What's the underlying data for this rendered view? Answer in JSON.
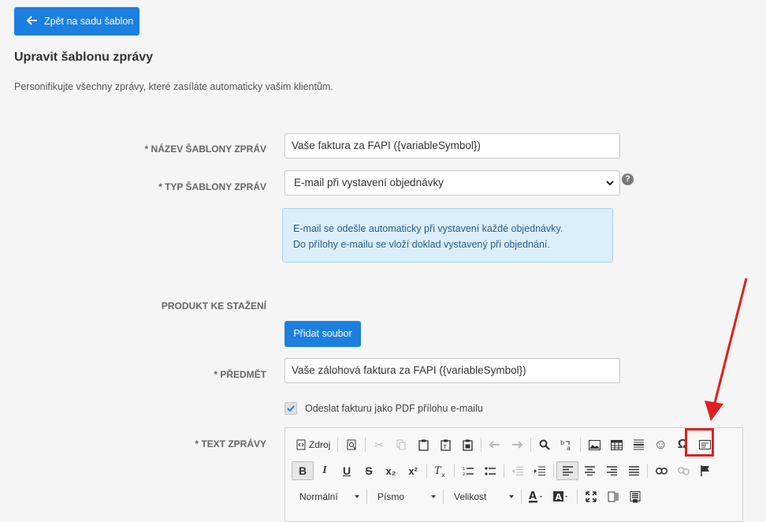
{
  "back_button": {
    "label": "Zpět na sadu šablon",
    "icon": "arrow-left-icon"
  },
  "page": {
    "title": "Upravit šablonu zprávy",
    "subtitle": "Personifikujte všechny zprávy, které zasíláte automaticky vašim klientům."
  },
  "form": {
    "name": {
      "label": "* NÁZEV ŠABLONY ZPRÁV",
      "value": "Vaše faktura za FAPI ({variableSymbol})"
    },
    "type": {
      "label": "* TYP ŠABLONY ZPRÁV",
      "value": "E-mail při vystavení objednávky",
      "help": "?"
    },
    "info": {
      "line1": "E-mail se odešle automaticky při vystavení každé objednávky.",
      "line2": "Do přílohy e-mailu se vloží doklad vystavený při objednání."
    },
    "download": {
      "label": "PRODUKT KE STAŽENÍ",
      "button": "Přidat soubor"
    },
    "subject": {
      "label": "* PŘEDMĚT",
      "value": "Vaše zálohová faktura za FAPI ({variableSymbol})"
    },
    "attach_pdf": {
      "label": "Odeslat fakturu jako PDF přílohu e-mailu",
      "checked": true
    },
    "body": {
      "label": "* TEXT ZPRÁVY"
    }
  },
  "editor": {
    "source_label": "Zdroj",
    "format_combo": "Normální",
    "font_combo": "Písmo",
    "size_combo": "Velikost",
    "superscript_glyph": "x²",
    "subscript_glyph": "x₂",
    "bold_glyph": "B",
    "italic_glyph": "I",
    "underline_glyph": "U",
    "strike_glyph": "S",
    "omega_glyph": "Ω",
    "smiley_glyph": "☺"
  },
  "colors": {
    "primary": "#1b7fe0",
    "info_bg": "#dbeefb",
    "highlight": "#e02020"
  }
}
